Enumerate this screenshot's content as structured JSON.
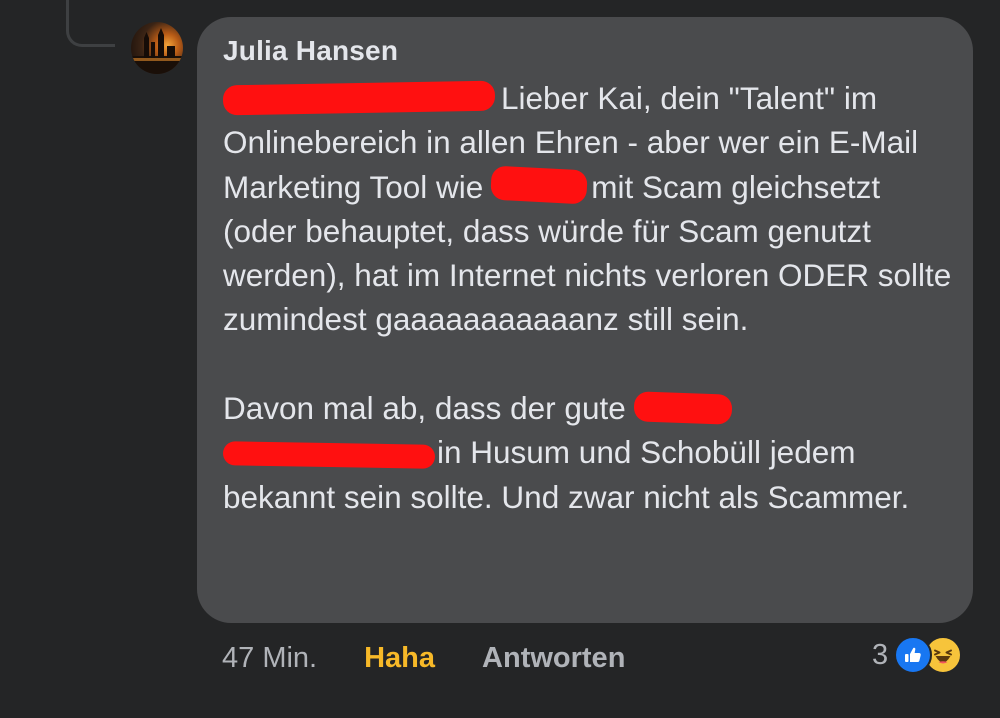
{
  "comment": {
    "author": "Julia Hansen",
    "paragraph1": {
      "part1": "Lieber Kai, dein \"Talent\" im Onlinebereich in allen Ehren - aber wer ein E-Mail Marketing Tool wie",
      "part2": "mit Scam gleichsetzt (oder behauptet, dass würde für Scam genutzt werden), hat im Internet nichts verloren ODER sollte zumindest gaaaaaaaaaaanz still sein."
    },
    "paragraph2": {
      "part1": "Davon mal ab, dass der gute",
      "part2": "in Husum und Schobüll jedem bekannt sein sollte. Und zwar nicht als Scammer."
    }
  },
  "meta": {
    "timestamp": "47 Min.",
    "reaction_label": "Haha",
    "reply_label": "Antworten",
    "reaction_count": "3"
  },
  "icons": {
    "avatar": "avatar-photo",
    "reactions": [
      "like-icon",
      "haha-icon"
    ]
  },
  "colors": {
    "background": "#242526",
    "bubble": "#4a4b4d",
    "text": "#e4e6eb",
    "muted": "#b0b3b8",
    "haha_active": "#f7b928",
    "like_blue": "#1877f2",
    "redaction": "#ff1010"
  }
}
